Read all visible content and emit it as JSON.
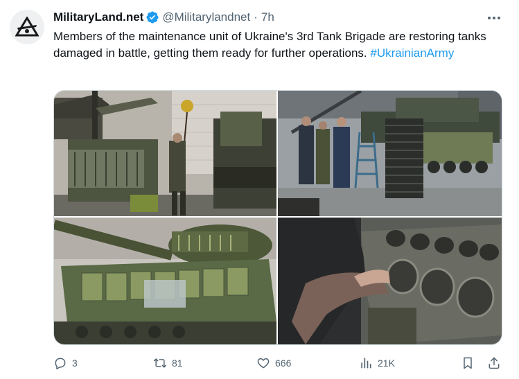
{
  "author": {
    "name": "MilitaryLand.net",
    "handle": "@Militarylandnet",
    "separator": "·",
    "time": "7h"
  },
  "post": {
    "text": "Members of the maintenance unit of Ukraine's 3rd Tank Brigade are restoring tanks damaged in battle, getting them ready for further operations. ",
    "hashtag": "#UkrainianArmy"
  },
  "media": {
    "photos": [
      {
        "icon": "photo-maintenance-workshop-tank"
      },
      {
        "icon": "photo-crew-beside-tank-tracks"
      },
      {
        "icon": "photo-camouflaged-tank-hull"
      },
      {
        "icon": "photo-engine-block-repair"
      }
    ]
  },
  "actions": {
    "replies": "3",
    "reposts": "81",
    "likes": "666",
    "views": "21K"
  },
  "colors": {
    "accent": "#1d9bf0",
    "text": "#0f1419",
    "secondary": "#536471",
    "border": "#cfd9de"
  }
}
